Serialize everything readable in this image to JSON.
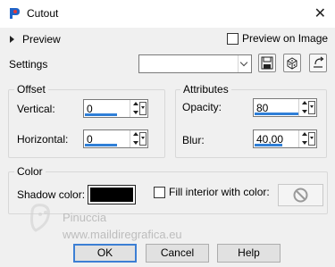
{
  "window": {
    "title": "Cutout",
    "close_glyph": "✕"
  },
  "preview": {
    "label": "Preview",
    "preview_on_image_label": "Preview on Image"
  },
  "settings": {
    "label": "Settings",
    "preset_value": ""
  },
  "offset": {
    "group_label": "Offset",
    "vertical_label": "Vertical:",
    "vertical_value": "0",
    "horizontal_label": "Horizontal:",
    "horizontal_value": "0"
  },
  "attributes": {
    "group_label": "Attributes",
    "opacity_label": "Opacity:",
    "opacity_value": "80",
    "blur_label": "Blur:",
    "blur_value": "40,00"
  },
  "color": {
    "group_label": "Color",
    "shadow_color_label": "Shadow color:",
    "shadow_color": "#000000",
    "fill_interior_label": "Fill interior with color:"
  },
  "watermark": {
    "name": "Pinuccia",
    "url": "www.maildiregrafica.eu"
  },
  "buttons": {
    "ok": "OK",
    "cancel": "Cancel",
    "help": "Help"
  },
  "accent_color": "#2f7fd7"
}
